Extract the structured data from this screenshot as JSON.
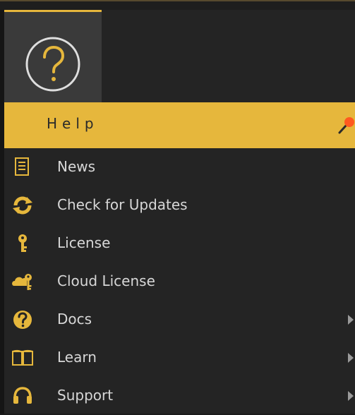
{
  "menu": {
    "section_title": "Help",
    "items": [
      {
        "label": "News",
        "icon": "news-icon",
        "submenu": false
      },
      {
        "label": "Check for Updates",
        "icon": "refresh-icon",
        "submenu": false
      },
      {
        "label": "License",
        "icon": "key-icon",
        "submenu": false
      },
      {
        "label": "Cloud License",
        "icon": "cloud-key-icon",
        "submenu": false
      },
      {
        "label": "Docs",
        "icon": "question-circle-icon",
        "submenu": true
      },
      {
        "label": "Learn",
        "icon": "book-icon",
        "submenu": true
      },
      {
        "label": "Support",
        "icon": "headset-icon",
        "submenu": true
      }
    ]
  },
  "colors": {
    "accent": "#e6b73c",
    "panel_bg": "#242424",
    "tile_bg": "#3a3a3a",
    "text": "#d7d7d7",
    "pin": "#ff5a1f"
  }
}
